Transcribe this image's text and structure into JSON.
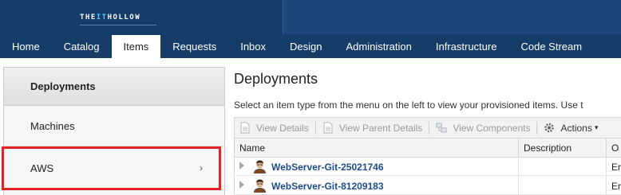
{
  "brand": {
    "logo_pre": "THE ",
    "logo_it": "IT",
    "logo_post": " HOLLOW"
  },
  "nav": {
    "tabs": [
      {
        "label": "Home",
        "active": false
      },
      {
        "label": "Catalog",
        "active": false
      },
      {
        "label": "Items",
        "active": true
      },
      {
        "label": "Requests",
        "active": false
      },
      {
        "label": "Inbox",
        "active": false
      },
      {
        "label": "Design",
        "active": false
      },
      {
        "label": "Administration",
        "active": false
      },
      {
        "label": "Infrastructure",
        "active": false
      },
      {
        "label": "Code Stream",
        "active": false
      }
    ]
  },
  "sidebar": {
    "items": [
      {
        "label": "Deployments"
      },
      {
        "label": "Machines"
      },
      {
        "label": "AWS",
        "chevron": "›"
      }
    ]
  },
  "main": {
    "title": "Deployments",
    "description": "Select an item type from the menu on the left to view your provisioned items. Use t",
    "toolbar": {
      "view_details": "View Details",
      "view_parent_details": "View Parent Details",
      "view_components": "View Components",
      "actions": "Actions",
      "actions_caret": "▾"
    },
    "table": {
      "columns": [
        "Name",
        "Description",
        "O"
      ],
      "rows": [
        {
          "name": "WebServer-Git-25021746",
          "owner": "Er"
        },
        {
          "name": "WebServer-Git-81209183",
          "owner": "Er"
        }
      ]
    }
  },
  "colors": {
    "nav_bg": "#163c68",
    "link": "#1d4e89",
    "highlight": "#e32227"
  },
  "icons": [
    "document-icon",
    "document-icon",
    "components-icon",
    "gear-icon",
    "expand-arrow-icon",
    "user-avatar-icon",
    "chevron-right-icon"
  ]
}
